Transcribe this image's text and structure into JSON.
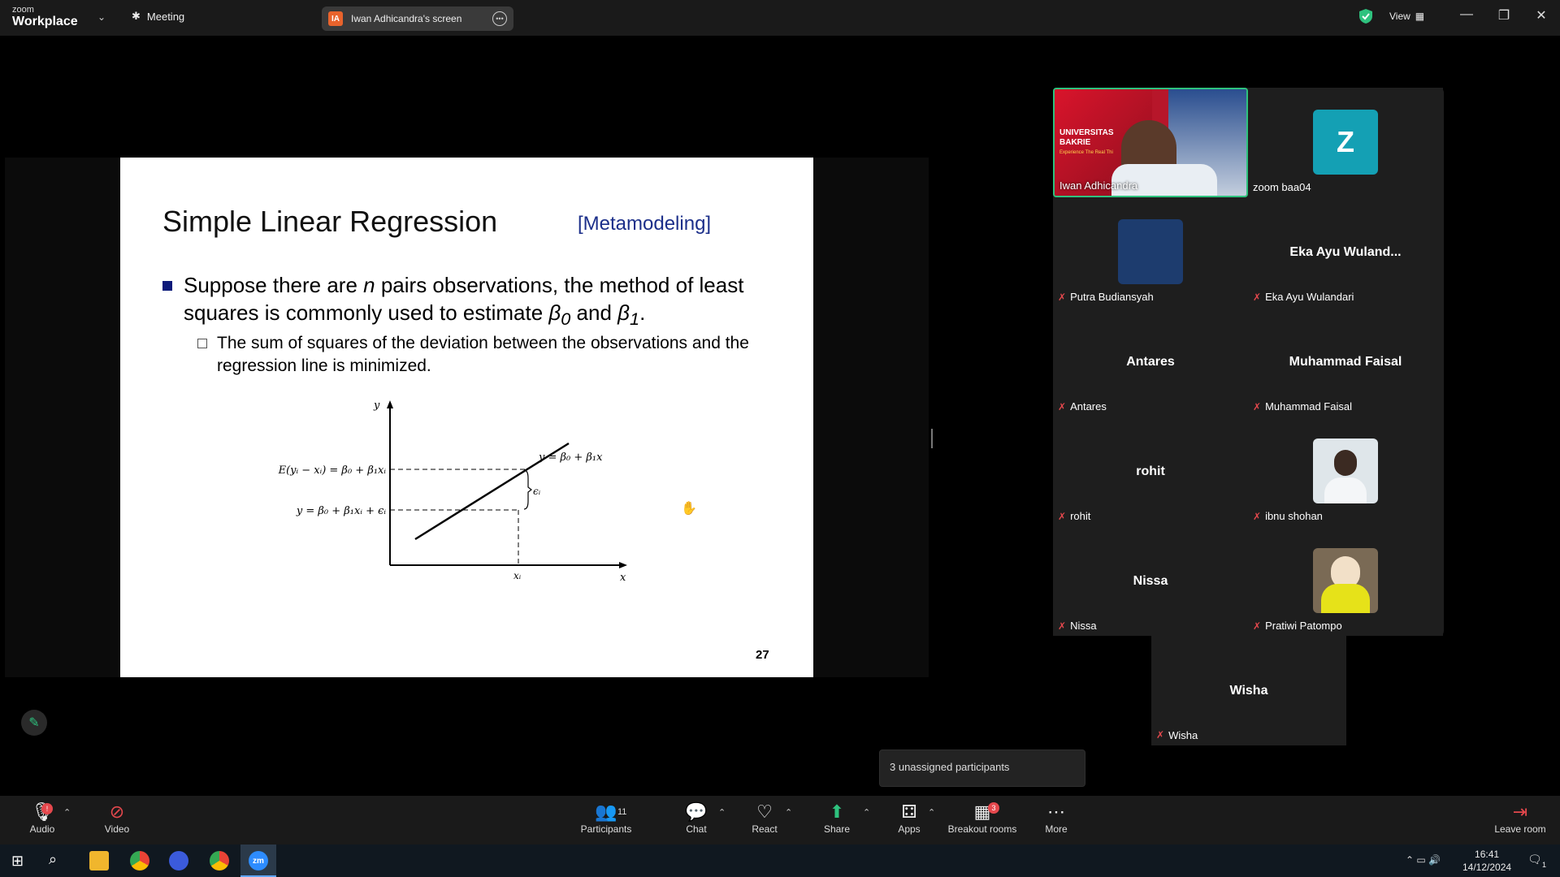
{
  "app": {
    "logo_top": "zoom",
    "logo_bottom": "Workplace",
    "meeting_label": "Meeting",
    "view_label": "View"
  },
  "share": {
    "presenter_label": "Iwan Adhicandra's screen",
    "presenter_initials": "IA"
  },
  "slide": {
    "title": "Simple Linear Regression",
    "tag": "[Metamodeling]",
    "bullet1_a": "Suppose there are ",
    "bullet1_n": "n",
    "bullet1_b": " pairs observations, the method of least squares is commonly used to estimate ",
    "bullet1_beta0": "β",
    "bullet1_sub0": "0",
    "bullet1_and": " and ",
    "bullet1_beta1": "β",
    "bullet1_sub1": "1",
    "bullet1_end": ".",
    "bullet2": "The sum of squares of the deviation between the observations and the regression line is minimized.",
    "page_number": "27",
    "graph": {
      "y_axis": "y",
      "x_axis": "x",
      "line_label": "y = β₀ + β₁x",
      "expect_label": "E(yᵢ − xᵢ) = β₀ + β₁xᵢ",
      "obs_label": "y = β₀ + β₁xᵢ + ϵᵢ",
      "eps_label": "ϵᵢ",
      "xi_label": "xᵢ"
    }
  },
  "participants_tiles": [
    {
      "name": "Iwan Adhicandra",
      "center": "",
      "avatar": "video",
      "muted": false
    },
    {
      "name": "zoom baa04",
      "center": "",
      "avatar": "Z",
      "muted": false
    },
    {
      "name": "Putra Budiansyah",
      "center": "",
      "avatar": "blue",
      "muted": true
    },
    {
      "name": "Eka Ayu Wulandari",
      "center": "Eka Ayu Wuland...",
      "avatar": "",
      "muted": true
    },
    {
      "name": "Antares",
      "center": "Antares",
      "avatar": "",
      "muted": true
    },
    {
      "name": "Muhammad Faisal",
      "center": "Muhammad Faisal",
      "avatar": "",
      "muted": true
    },
    {
      "name": "rohit",
      "center": "rohit",
      "avatar": "",
      "muted": true
    },
    {
      "name": "ibnu shohan",
      "center": "",
      "avatar": "photo",
      "muted": true
    },
    {
      "name": "Nissa",
      "center": "Nissa",
      "avatar": "",
      "muted": true
    },
    {
      "name": "Pratiwi Patompo",
      "center": "",
      "avatar": "photo-yellow",
      "muted": true
    },
    {
      "name": "Wisha",
      "center": "Wisha",
      "avatar": "",
      "muted": true
    }
  ],
  "video_banner": {
    "line1": "UNIVERSITAS",
    "line2": "BAKRIE",
    "line3": "Experience The Real Thi"
  },
  "unassigned": "3 unassigned participants",
  "toolbar": {
    "audio": "Audio",
    "video": "Video",
    "participants": "Participants",
    "participants_count": "11",
    "chat": "Chat",
    "react": "React",
    "share": "Share",
    "apps": "Apps",
    "breakout": "Breakout rooms",
    "breakout_badge": "3",
    "more": "More",
    "leave": "Leave room",
    "audio_badge": "!"
  },
  "taskbar": {
    "time": "16:41",
    "date": "14/12/2024",
    "notif": "1"
  },
  "colors": {
    "accent_green": "#2ec27e",
    "mute_red": "#e5484d",
    "slide_blue": "#1c2f8a",
    "avatar_teal": "#14a0b4"
  }
}
